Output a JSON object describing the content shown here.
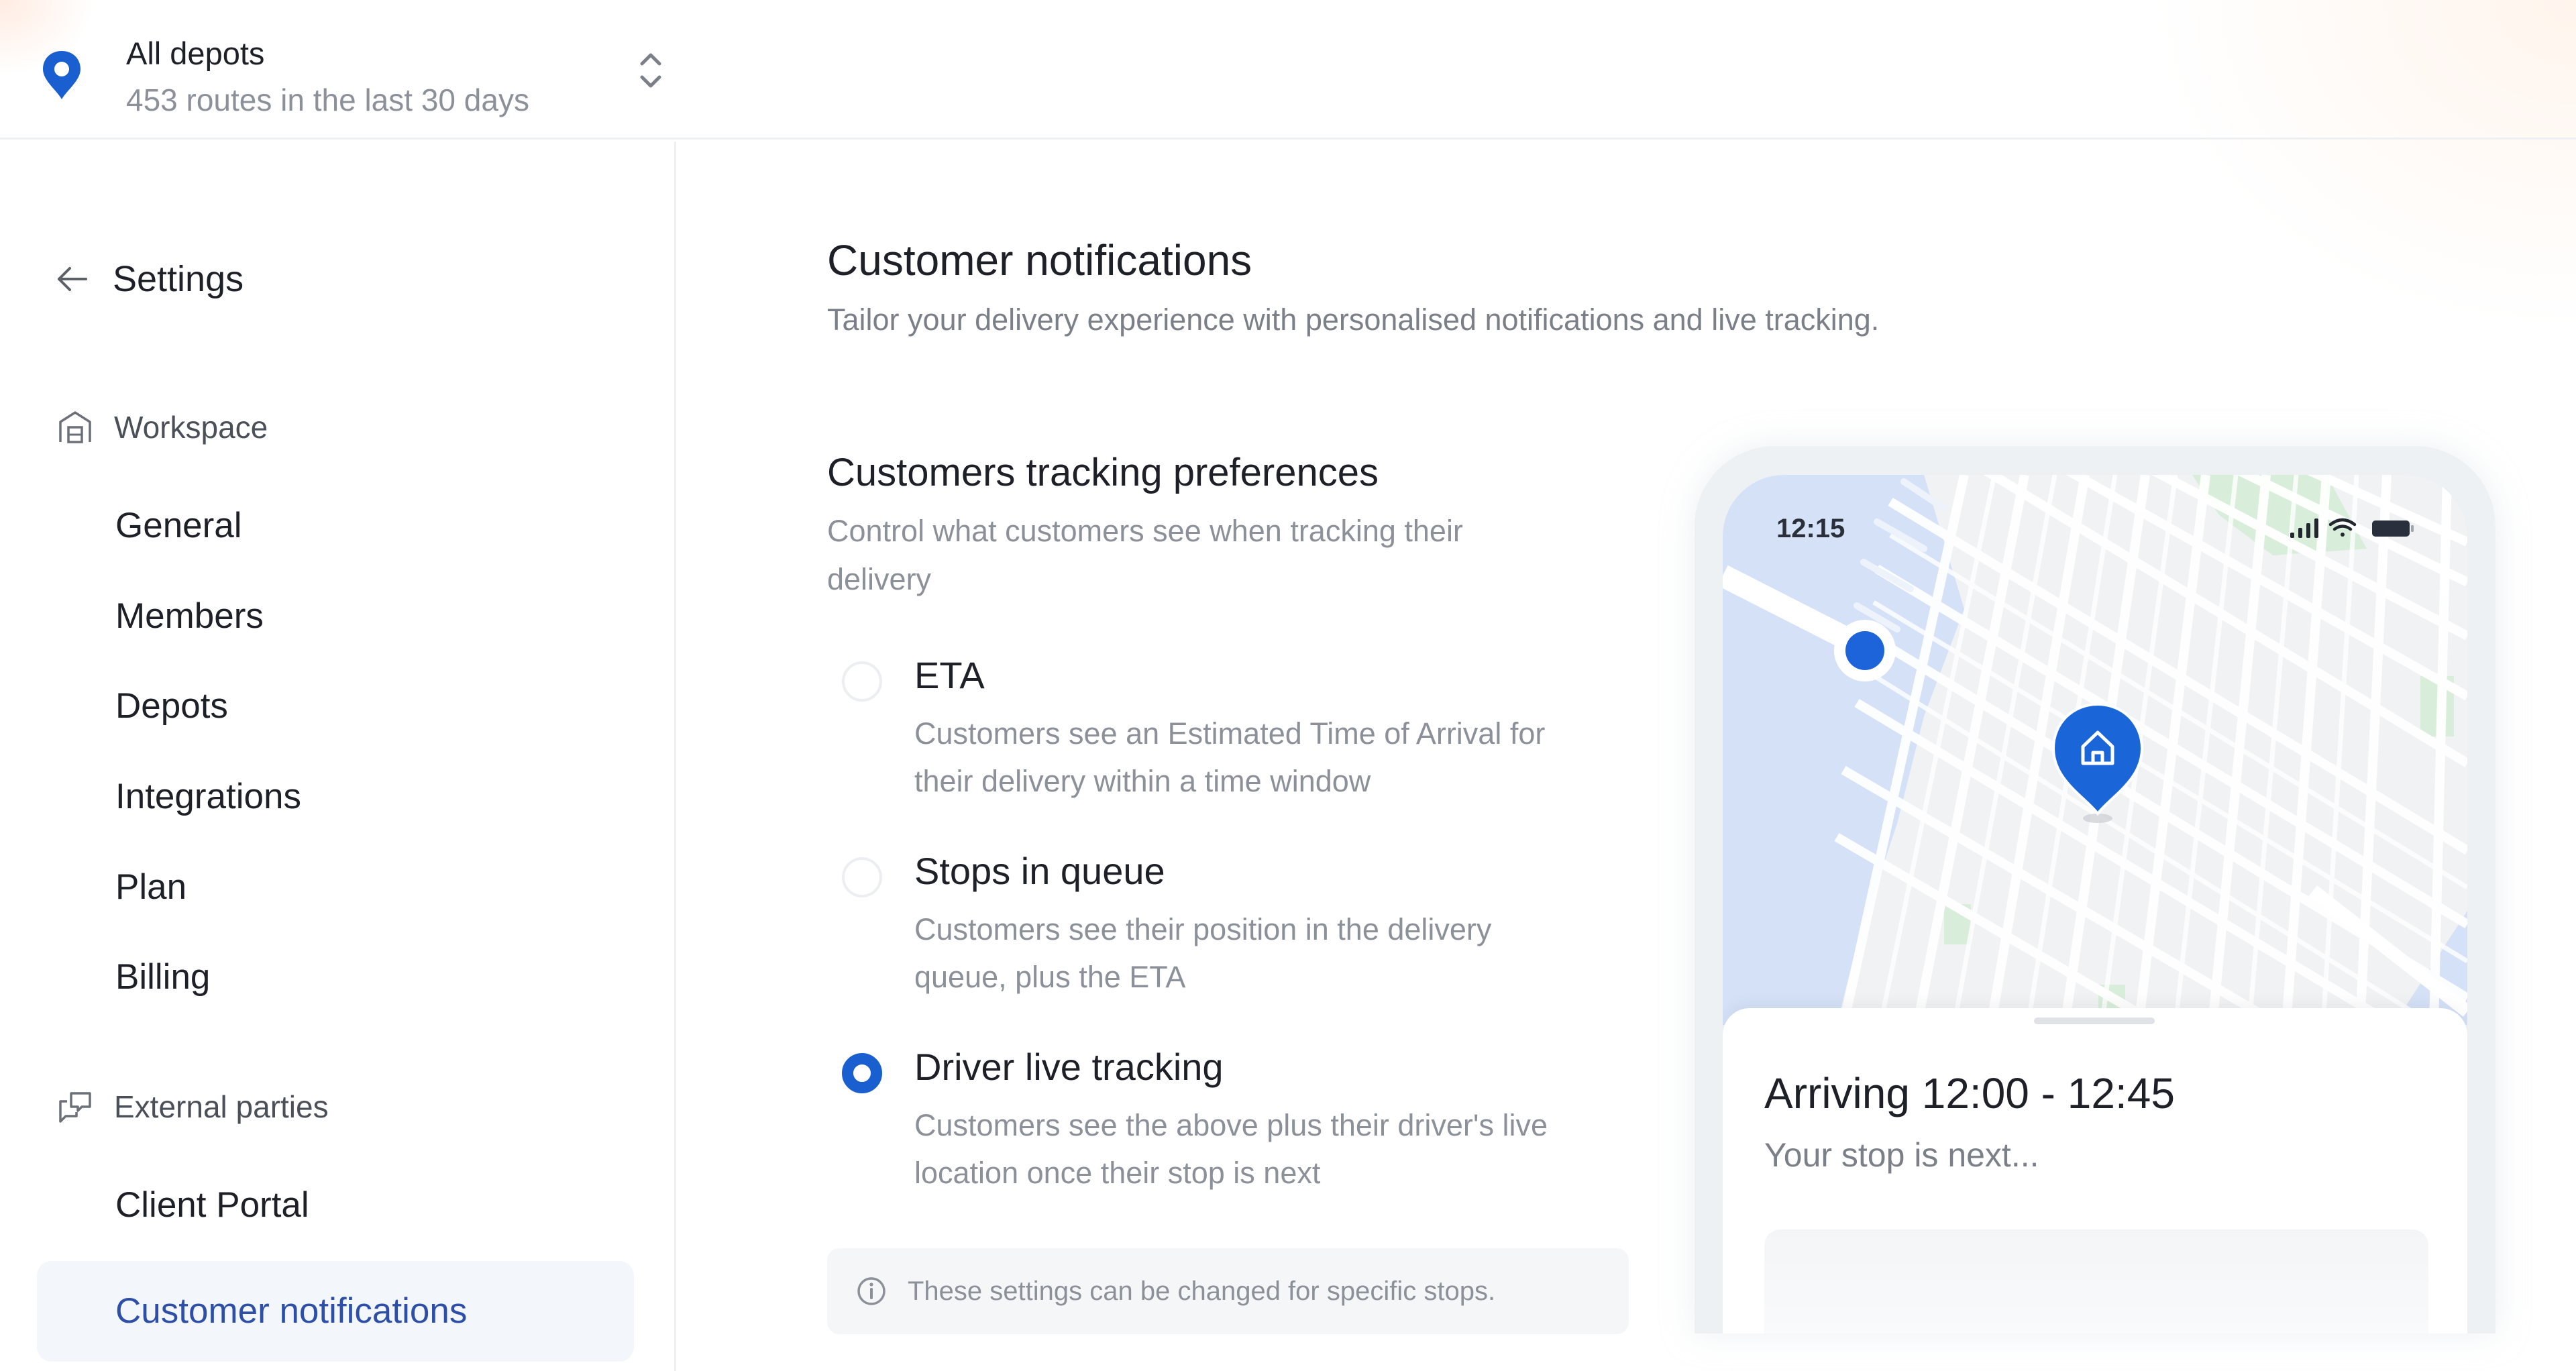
{
  "header": {
    "depot_name": "All depots",
    "depot_summary": "453 routes in the last 30 days",
    "pin_icon": "map-pin-icon",
    "selector_icon": "chevron-up-down-icon"
  },
  "sidebar": {
    "back_label": "Settings",
    "groups": [
      {
        "label": "Workspace",
        "icon": "building-icon",
        "items": [
          {
            "label": "General"
          },
          {
            "label": "Members"
          },
          {
            "label": "Depots"
          },
          {
            "label": "Integrations"
          },
          {
            "label": "Plan"
          },
          {
            "label": "Billing"
          }
        ]
      },
      {
        "label": "External parties",
        "icon": "chat-bubbles-icon",
        "items": [
          {
            "label": "Client Portal"
          },
          {
            "label": "Customer notifications",
            "active": true
          }
        ]
      }
    ]
  },
  "main": {
    "title": "Customer notifications",
    "subtitle": "Tailor your delivery experience with personalised notifications and live tracking.",
    "section": {
      "title": "Customers tracking preferences",
      "description": "Control what customers see when tracking their delivery",
      "options": [
        {
          "label": "ETA",
          "description": "Customers see an Estimated Time of Arrival for their delivery within a time window",
          "selected": false
        },
        {
          "label": "Stops in queue",
          "description": "Customers see their position in the delivery queue, plus the ETA",
          "selected": false
        },
        {
          "label": "Driver live tracking",
          "description": "Customers see the above plus their driver's live location once their stop is next",
          "selected": true
        }
      ]
    },
    "info_note": "These settings can be changed for specific stops."
  },
  "phone_preview": {
    "status_time": "12:15",
    "arriving_text": "Arriving 12:00 - 12:45",
    "stop_status": "Your stop is next...",
    "driver_marker": "driver-location-dot",
    "destination_marker": "home-pin-icon"
  },
  "colors": {
    "accent": "#1a5fd0",
    "active_nav_text": "#2d4fa8",
    "active_nav_bg": "#f3f7fb",
    "map_water": "#d4e1f7",
    "map_park": "#d8eedb"
  }
}
